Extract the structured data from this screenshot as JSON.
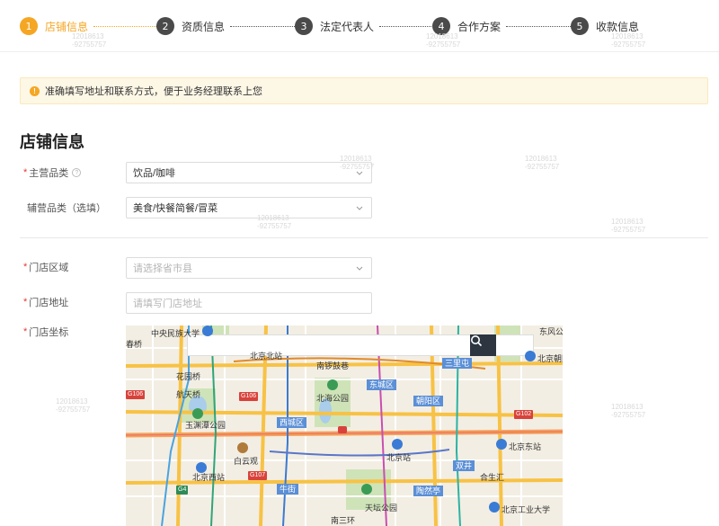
{
  "steps": [
    {
      "num": "1",
      "label": "店铺信息"
    },
    {
      "num": "2",
      "label": "资质信息"
    },
    {
      "num": "3",
      "label": "法定代表人"
    },
    {
      "num": "4",
      "label": "合作方案"
    },
    {
      "num": "5",
      "label": "收款信息"
    }
  ],
  "notice": {
    "text": "准确填写地址和联系方式，便于业务经理联系上您"
  },
  "section": {
    "title": "店铺信息"
  },
  "form": {
    "main_category": {
      "label": "主营品类",
      "value": "饮品/咖啡"
    },
    "sub_category": {
      "label": "辅营品类（选填）",
      "value": "美食/快餐简餐/冒菜"
    },
    "region": {
      "label": "门店区域",
      "placeholder": "请选择省市县"
    },
    "address": {
      "label": "门店地址",
      "placeholder": "请填写门店地址"
    },
    "coords": {
      "label": "门店坐标"
    }
  },
  "map": {
    "labels": {
      "minzu": "中央民族大学",
      "beijingbei": "北京北站",
      "nanluogu": "南锣鼓巷",
      "huayuanqiao": "花园桥",
      "hangtianqiao": "航天桥",
      "beihai": "北海公园",
      "dongcheng": "东城区",
      "chaoyang": "朝阳区",
      "xicheng": "西城区",
      "yuyuantan": "玉渊潭公园",
      "baiyunguan": "白云观",
      "beijingxi": "北京西站",
      "beijingzhan": "北京站",
      "beijingdong": "北京东站",
      "hesheng": "合生汇",
      "tiantan": "天坛公园",
      "sanlitun": "三里屯",
      "dongfeng": "东风公",
      "beijingchaoyang": "北京朝阳站",
      "gongye": "北京工业大学",
      "shuangjing": "双井",
      "niujie": "牛街",
      "taoranting": "陶然亭",
      "nansanhuan": "南三环",
      "chuangchun": "春桥"
    },
    "roads": {
      "g106": "G106",
      "g106b": "G106",
      "g107": "G107",
      "g102": "G102",
      "g4": "G4"
    }
  },
  "watermark": {
    "line1": "12018613",
    "line2": "-92755757"
  }
}
